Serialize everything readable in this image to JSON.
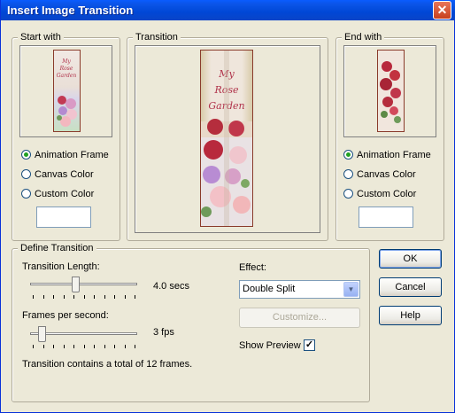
{
  "window": {
    "title": "Insert Image Transition"
  },
  "start_with": {
    "legend": "Start with",
    "options": [
      "Animation Frame",
      "Canvas Color",
      "Custom Color"
    ],
    "selected": 0
  },
  "transition": {
    "legend": "Transition",
    "card_text": "My Rose Garden"
  },
  "end_with": {
    "legend": "End with",
    "options": [
      "Animation Frame",
      "Canvas Color",
      "Custom Color"
    ],
    "selected": 0
  },
  "define_transition": {
    "legend": "Define Transition",
    "length_label": "Transition Length:",
    "length_value": "4.0 secs",
    "length_slider_fraction": 0.42,
    "fps_label": "Frames per second:",
    "fps_value": "3 fps",
    "fps_slider_fraction": 0.08,
    "summary": "Transition contains a total of 12 frames.",
    "effect_label": "Effect:",
    "effect_value": "Double Split",
    "customize_label": "Customize...",
    "show_preview_label": "Show Preview",
    "show_preview_checked": true
  },
  "buttons": {
    "ok": "OK",
    "cancel": "Cancel",
    "help": "Help"
  },
  "colors": {
    "accent": "#0a5cff",
    "card_frame": "#8a3b2b",
    "rose": "#b0324a"
  }
}
